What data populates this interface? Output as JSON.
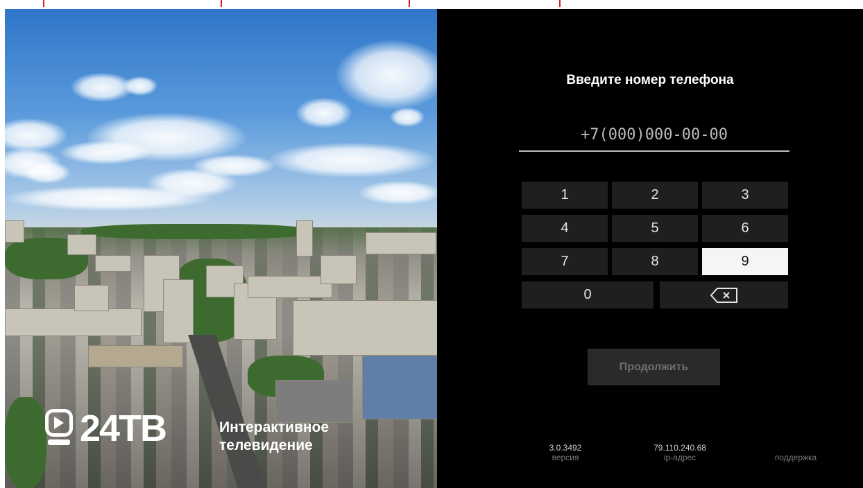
{
  "brand": {
    "logo_text": "24ТВ",
    "tagline_line1": "Интерактивное",
    "tagline_line2": "телевидение"
  },
  "login": {
    "title": "Введите номер телефона",
    "phone_placeholder": "+7(000)000-00-00",
    "keys": [
      "1",
      "2",
      "3",
      "4",
      "5",
      "6",
      "7",
      "8",
      "9",
      "0"
    ],
    "selected_key": "9",
    "backspace_icon": "backspace-icon",
    "continue_label": "Продолжить"
  },
  "footer": {
    "version_value": "3.0.3492",
    "version_label": "версия",
    "ip_value": "79.110.240.68",
    "ip_label": "ip-адрес",
    "support_label": "поддержка"
  },
  "colors": {
    "panel_bg": "#000000",
    "key_bg": "#1f1f1f",
    "key_active_bg": "#f5f5f5",
    "button_bg": "#2a2a2a",
    "accent_marks": "#e31b23"
  }
}
